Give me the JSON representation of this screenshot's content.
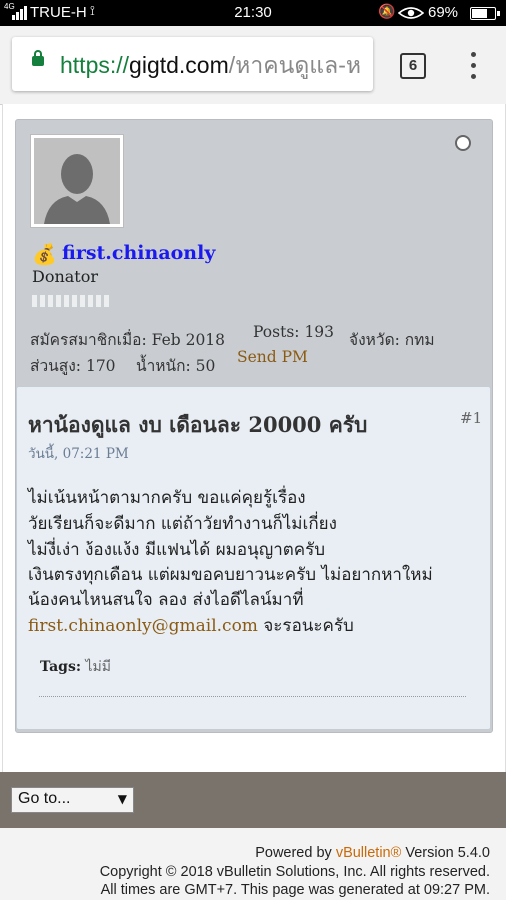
{
  "status_bar": {
    "network": "4G",
    "carrier": "TRUE-H",
    "time": "21:30",
    "battery": "69%"
  },
  "browser": {
    "url_scheme": "https://",
    "url_host": "gigtd.com",
    "url_path": "/หาคนดูแล-ห",
    "tab_count": "6"
  },
  "post": {
    "username_icon": "💰",
    "username": "first.chinaonly",
    "user_title": "Donator",
    "joined_label": "สมัครสมาชิกเมื่อ:",
    "joined_value": "Feb 2018",
    "posts_label": "Posts:",
    "posts_value": "193",
    "province_label": "จังหวัด:",
    "province_value": "กทม",
    "height_label": "ส่วนสูง:",
    "height_value": "170",
    "weight_label": "น้ำหนัก:",
    "weight_value": "50",
    "send_pm": "Send PM",
    "title": "หาน้องดูแล งบ เดือนละ 20000 ครับ",
    "number": "#1",
    "date": "วันนี้, 07:21 PM",
    "lines": [
      "ไม่เน้นหน้าตามากครับ ขอแค่คุยรู้เรื่อง",
      "วัยเรียนก็จะดีมาก แต่ถ้าวัยทำงานก็ไม่เกี่ยง",
      "ไม่งี่เง่า ง้องแง้ง มีแฟนได้ ผมอนุญาตครับ",
      "เงินตรงทุกเดือน แต่ผมขอคบยาวนะครับ ไม่อยากหาใหม่",
      "น้องคนไหนสนใจ ลอง ส่งไอดีไลน์มาที่"
    ],
    "email": "first.chinaonly@gmail.com",
    "email_suffix": "จะรอนะครับ",
    "tags_label": "Tags:",
    "tags_value": "ไม่มี"
  },
  "nav": {
    "goto_label": "Go to..."
  },
  "footer": {
    "powered_prefix": "Powered by",
    "powered_link": "vBulletin®",
    "powered_suffix": "Version 5.4.0",
    "copyright": "Copyright © 2018 vBulletin Solutions, Inc. All rights reserved.",
    "times": "All times are GMT+7. This page was generated at 09:27 PM."
  },
  "colors": {
    "link_blue": "#1a1aee",
    "accent_brown": "#8a5a12",
    "secure_green": "#15803d",
    "vb_orange": "#c96a0a"
  }
}
